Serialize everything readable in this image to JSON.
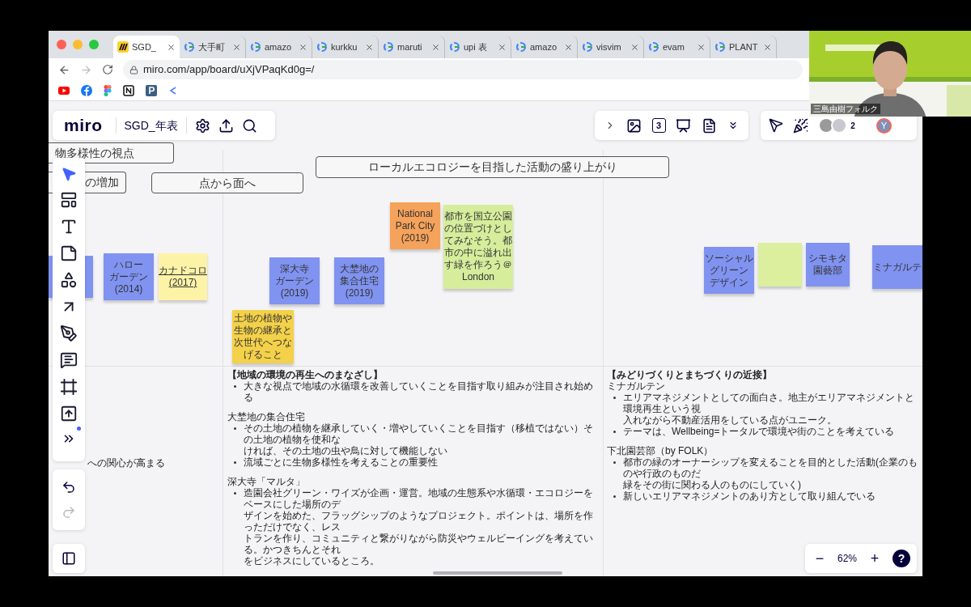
{
  "browser": {
    "tabs": [
      {
        "label": "SGD_",
        "selected": true,
        "kind": "board"
      },
      {
        "label": "大手町",
        "selected": false,
        "kind": "search"
      },
      {
        "label": "amazo",
        "selected": false,
        "kind": "search"
      },
      {
        "label": "kurkku",
        "selected": false,
        "kind": "search"
      },
      {
        "label": "maruti",
        "selected": false,
        "kind": "search"
      },
      {
        "label": "upi 表",
        "selected": false,
        "kind": "search"
      },
      {
        "label": "amazo",
        "selected": false,
        "kind": "search"
      },
      {
        "label": "visvim",
        "selected": false,
        "kind": "search"
      },
      {
        "label": "evam",
        "selected": false,
        "kind": "search"
      },
      {
        "label": "PLANT",
        "selected": false,
        "kind": "search"
      }
    ],
    "url": "miro.com/app/board/uXjVPaqKd0g=/"
  },
  "board": {
    "logo": "miro",
    "title": "SGD_年表",
    "count_badge": "3",
    "collaborators": "2",
    "user_initial": "Y",
    "zoom_out": "−",
    "zoom": "62%",
    "zoom_in": "+",
    "help": "?"
  },
  "headings": [
    "物多様性の視点",
    "の増加",
    "点から面へ",
    "ローカルエコロジーを目指した活動の盛り上がり"
  ],
  "stickies": [
    {
      "color": "#8093f1"
    },
    {
      "lines": [
        "ハロー",
        "ガーデン",
        "(2014)"
      ],
      "color": "#8093f1",
      "underlined": false
    },
    {
      "lines": [
        "カナドコロ",
        "(2017)"
      ],
      "color": "#fdf3a7",
      "underlined": true
    },
    {
      "lines": [
        "深大寺",
        "ガーデン",
        "(2019)"
      ],
      "color": "#8093f1",
      "underlined": false
    },
    {
      "lines": [
        "大埜地の",
        "集合住宅",
        "(2019)"
      ],
      "color": "#8093f1",
      "underlined": false
    },
    {
      "lines": [
        "National",
        "Park City",
        "(2019)"
      ],
      "color": "#f5a25b",
      "underlined": false
    },
    {
      "lines": [
        "都市を国立公園の位置づけとしてみなそう。都市の中に溢れ出す緑を作ろう＠London"
      ],
      "color": "#d6ed9c",
      "underlined": false
    },
    {
      "lines": [
        "土地の植物や",
        "生物の継承と",
        "次世代へつな",
        "げること"
      ],
      "color": "#f4d14a",
      "underlined": false
    },
    {
      "lines": [
        "ソーシャル",
        "グリーン",
        "デザイン"
      ],
      "color": "#8093f1",
      "underlined": false
    },
    {
      "color": "#dcef9e"
    },
    {
      "lines": [
        "シモキタ",
        "園藝部"
      ],
      "color": "#8093f1",
      "underlined": false
    },
    {
      "lines": [
        "ミナガルテ"
      ],
      "color": "#8093f1",
      "underlined": false
    }
  ],
  "notes": [
    {
      "title": "【地域の環境の再生へのまなざし】",
      "sections": [
        {
          "bullets": [
            {
              "lines": [
                "大きな視点で地域の水循環を改善していくことを目指す取り組みが注目され始める"
              ]
            }
          ]
        },
        {
          "heading": "大埜地の集合住宅",
          "bullets": [
            {
              "lines": [
                "その土地の植物を継承していく・増やしていくことを目指す（移植ではない）その土地の植物を使和な",
                "ければ、その土地の虫や鳥に対して機能しない"
              ]
            },
            {
              "lines": [
                "流域ごとに生物多様性を考えることの重要性"
              ]
            }
          ]
        },
        {
          "heading": "深大寺「マルタ」",
          "bullets": [
            {
              "lines": [
                "造園会社グリーン・ワイズが企画・運営。地域の生態系や水循環・エコロジーをベースにした場所のデ",
                "ザインを始めた、フラッグシップのようなプロジェクト。ポイントは、場所を作っただけでなく、レス",
                "トランを作り、コミュニティと繋がりながら防災やウェルビーイングを考えている。かつきちんとそれ",
                "をビジネスにしているところ。"
              ]
            }
          ]
        }
      ]
    },
    {
      "title": "【みどりづくりとまちづくりの近接】",
      "sections": [
        {
          "heading": "ミナガルテン",
          "bullets": [
            {
              "lines": [
                "エリアマネジメントとしての面白さ。地主がエリアマネジメントと環境再生という視",
                "入れながら不動産活用をしている点がユニーク。"
              ]
            },
            {
              "lines": [
                "テーマは、Wellbeing=トータルで環境や街のことを考えている"
              ]
            }
          ]
        },
        {
          "heading": "下北園芸部（by FOLK）",
          "bullets": [
            {
              "lines": [
                "都市の緑のオーナーシップを変えることを目的とした活動(企業のものや行政のものだ",
                "緑をその街に関わる人のものにしていく)"
              ]
            },
            {
              "lines": [
                "新しいエリアマネジメントのあり方として取り組んでいる"
              ]
            }
          ]
        }
      ]
    }
  ],
  "side_note": "への関心が高まる",
  "video": {
    "name": "三島由樹フォルク"
  }
}
